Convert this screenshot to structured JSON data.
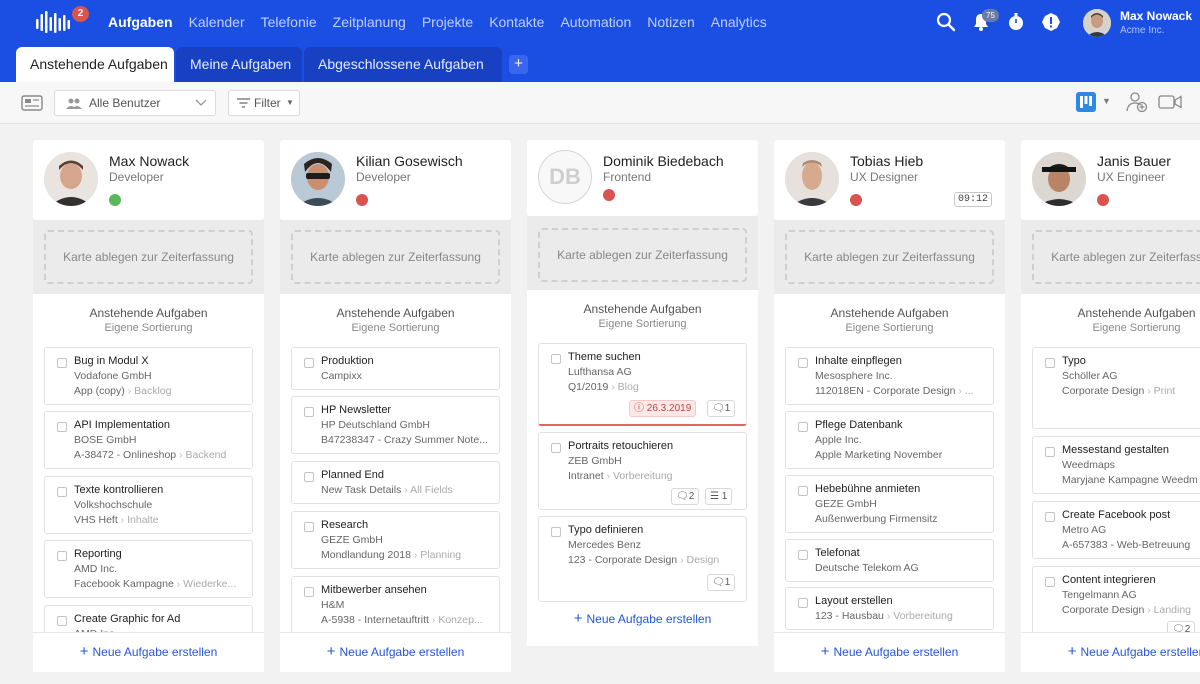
{
  "app": {
    "logo_badge": "2"
  },
  "nav": [
    "Aufgaben",
    "Kalender",
    "Telefonie",
    "Zeitplanung",
    "Projekte",
    "Kontakte",
    "Automation",
    "Notizen",
    "Analytics"
  ],
  "header": {
    "notification_count": "75",
    "user_name": "Max Nowack",
    "user_company": "Acme Inc."
  },
  "tabs": [
    "Anstehende Aufgaben",
    "Meine Aufgaben",
    "Abgeschlossene Aufgaben"
  ],
  "tab_add_label": "+",
  "toolbar": {
    "user_filter": "Alle Benutzer",
    "filter_label": "Filter"
  },
  "columns": [
    {
      "name": "Max Nowack",
      "role": "Developer",
      "status_color": "#5cb85c",
      "time": "",
      "drop_label": "Karte ablegen zur Zeiterfassung",
      "section_title": "Anstehende Aufgaben",
      "section_sub": "Eigene Sortierung",
      "tasks": [
        {
          "title": "Bug in Modul X",
          "line1": "Vodafone GmbH",
          "line2": "App (copy)",
          "line2_tag": "Backlog"
        },
        {
          "title": "API Implementation",
          "line1": "BOSE GmbH",
          "line2": "A-38472 - Onlineshop",
          "line2_tag": "Backend"
        },
        {
          "title": "Texte kontrollieren",
          "line1": "Volkshochschule",
          "line2": "VHS Heft",
          "line2_tag": "Inhalte"
        },
        {
          "title": "Reporting",
          "line1": "AMD Inc.",
          "line2": "Facebook Kampagne",
          "line2_tag": "Wiederke..."
        },
        {
          "title": "Create Graphic for Ad",
          "line1": "AMD Inc."
        }
      ],
      "add_label": "Neue Aufgabe erstellen"
    },
    {
      "name": "Kilian Gosewisch",
      "role": "Developer",
      "status_color": "#d9534f",
      "time": "",
      "drop_label": "Karte ablegen zur Zeiterfassung",
      "section_title": "Anstehende Aufgaben",
      "section_sub": "Eigene Sortierung",
      "tasks": [
        {
          "title": "Produktion",
          "line1": "Campixx"
        },
        {
          "title": "HP Newsletter",
          "line1": "HP Deutschland GmbH",
          "line2": "B47238347 - Crazy Summer Note..."
        },
        {
          "title": "Planned End",
          "line1": "New Task Details",
          "line1_tag": "All Fields"
        },
        {
          "title": "Research",
          "line1": "GEZE GmbH",
          "line2": "Mondlandung 2018",
          "line2_tag": "Planning"
        },
        {
          "title": "Mitbewerber ansehen",
          "line1": "H&M",
          "line2": "A-5938 - Internetauftritt",
          "line2_tag": "Konzep..."
        }
      ],
      "add_label": "Neue Aufgabe erstellen"
    },
    {
      "name": "Dominik Biedebach",
      "role": "Frontend",
      "initials": "DB",
      "status_color": "#d9534f",
      "time": "",
      "drop_label": "Karte ablegen zur Zeiterfassung",
      "section_title": "Anstehende Aufgaben",
      "section_sub": "Eigene Sortierung",
      "tasks": [
        {
          "title": "Theme suchen",
          "line1": "Lufthansa AG",
          "line2": "Q1/2019",
          "line2_tag": "Blog",
          "due": "26.3.2019",
          "comments": "1"
        },
        {
          "title": "Portraits retouchieren",
          "line1": "ZEB GmbH",
          "line2": "Intranet",
          "line2_tag": "Vorbereitung",
          "comments": "2",
          "checklist": "1"
        },
        {
          "title": "Typo definieren",
          "line1": "Mercedes Benz",
          "line2": "123 - Corporate Design",
          "line2_tag": "Design",
          "comments": "1"
        }
      ],
      "add_label": "Neue Aufgabe erstellen"
    },
    {
      "name": "Tobias Hieb",
      "role": "UX Designer",
      "status_color": "#d9534f",
      "time": "09:12",
      "drop_label": "Karte ablegen zur Zeiterfassung",
      "section_title": "Anstehende Aufgaben",
      "section_sub": "Eigene Sortierung",
      "tasks": [
        {
          "title": "Inhalte einpflegen",
          "line1": "Mesosphere Inc.",
          "line2": "112018EN - Corporate Design",
          "line2_tag": "..."
        },
        {
          "title": "Pflege Datenbank",
          "line1": "Apple Inc.",
          "line2": "Apple Marketing November"
        },
        {
          "title": "Hebebühne anmieten",
          "line1": "GEZE GmbH",
          "line2": "Außenwerbung Firmensitz"
        },
        {
          "title": "Telefonat",
          "line1": "Deutsche Telekom AG"
        },
        {
          "title": "Layout erstellen",
          "line1": "123 - Hausbau",
          "line1_tag": "Vorbereitung"
        }
      ],
      "add_label": "Neue Aufgabe erstellen"
    },
    {
      "name": "Janis Bauer",
      "role": "UX Engineer",
      "status_color": "#d9534f",
      "time": "",
      "drop_label": "Karte ablegen zur Zeiterfassung",
      "section_title": "Anstehende Aufgaben",
      "section_sub": "Eigene Sortierung",
      "tasks": [
        {
          "title": "Typo",
          "line1": "Schöller AG",
          "line2": "Corporate Design",
          "line2_tag": "Print"
        },
        {
          "title": "Messestand gestalten",
          "line1": "Weedmaps",
          "line2": "Maryjane Kampagne Weedm"
        },
        {
          "title": "Create Facebook post",
          "line1": "Metro AG",
          "line2": "A-657383 - Web-Betreuung"
        },
        {
          "title": "Content integrieren",
          "line1": "Tengelmann AG",
          "line2": "Corporate Design",
          "line2_tag": "Landing",
          "comments": "2"
        }
      ],
      "add_label": "Neue Aufgabe erstellen"
    }
  ],
  "colors": {
    "brand": "#1b4fe4",
    "link": "#2457d6",
    "online": "#5cb85c",
    "busy": "#d9534f"
  }
}
